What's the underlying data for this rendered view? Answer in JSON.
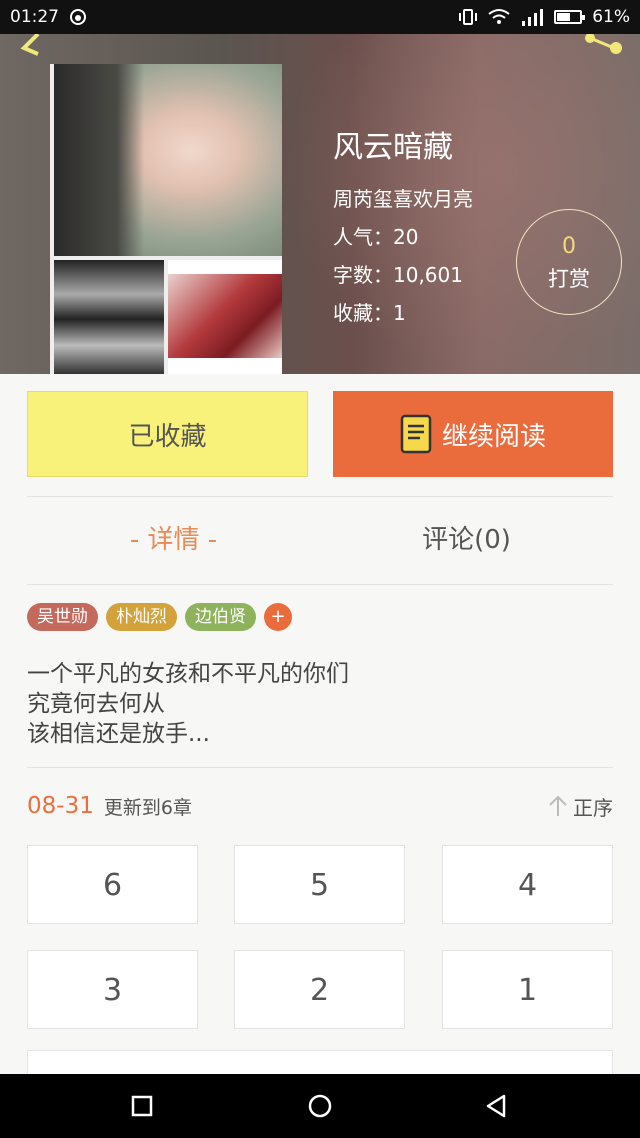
{
  "status_bar": {
    "time": "01:27",
    "battery": "61%",
    "battery_level": 0.61
  },
  "book": {
    "title": "风云暗藏",
    "author": "周芮玺喜欢月亮",
    "popularity": "人气：20",
    "word_count": "字数：10,601",
    "favorites": "收藏：1"
  },
  "reward": {
    "count": "0",
    "label": "打赏"
  },
  "actions": {
    "collect_label": "已收藏",
    "read_label": "继续阅读"
  },
  "tabs": {
    "detail": "- 详情 -",
    "comments": "评论(0)"
  },
  "tags": [
    {
      "label": "吴世勋",
      "color": "#c46a5c"
    },
    {
      "label": "朴灿烈",
      "color": "#d3a23a"
    },
    {
      "label": "边伯贤",
      "color": "#8fb35d"
    }
  ],
  "tag_add": "+",
  "description": [
    "一个平凡的女孩和不平凡的你们",
    "究竟何去何从",
    "该相信还是放手..."
  ],
  "update": {
    "date": "08-31",
    "text": "更新到6章",
    "sort_label": "正序"
  },
  "chapters": [
    "6",
    "5",
    "4",
    "3",
    "2",
    "1"
  ],
  "colors": {
    "accent": "#ea6b3c",
    "collect": "#f8f27a",
    "tab_active": "#ea8a55"
  }
}
